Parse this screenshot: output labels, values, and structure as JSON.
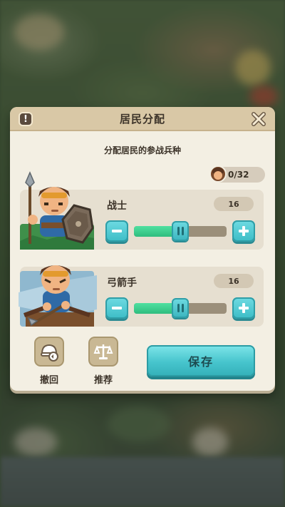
{
  "dialog": {
    "title": "居民分配",
    "subtitle": "分配居民的参战兵种",
    "info_icon": "info-icon",
    "close_icon": "close-icon"
  },
  "population": {
    "value": "0/32",
    "icon": "resident-avatar-icon"
  },
  "units": [
    {
      "name": "战士",
      "count": "16",
      "fill_fraction": 0.5,
      "portrait": "warrior-portrait"
    },
    {
      "name": "弓箭手",
      "count": "16",
      "fill_fraction": 0.5,
      "portrait": "archer-portrait"
    }
  ],
  "actions": {
    "undo_label": "撤回",
    "undo_icon": "helmet-undo-icon",
    "recommend_label": "推荐",
    "recommend_icon": "scales-icon",
    "save_label": "保存"
  },
  "colors": {
    "accent": "#46c4cc",
    "slider_fill": "#2fbd7e",
    "panel": "#f3efe3",
    "header": "#d9c8a6"
  }
}
